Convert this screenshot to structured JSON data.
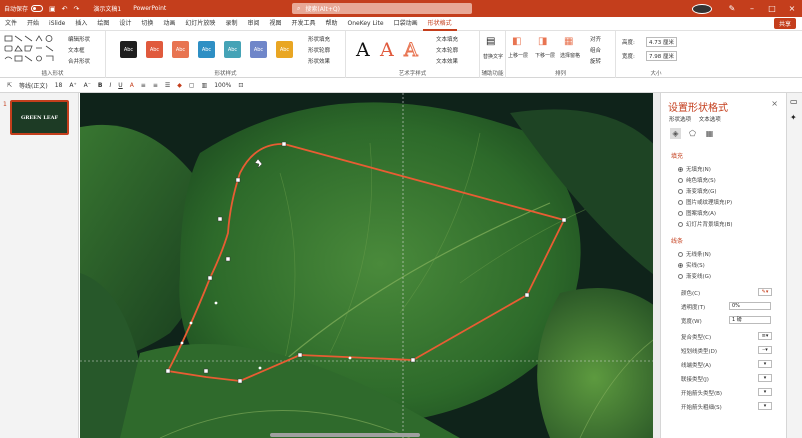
{
  "titlebar": {
    "autosave": "自动保存",
    "filename": "演示文稿1",
    "app": "PowerPoint",
    "search_placeholder": "搜索(Alt+Q)",
    "share": "共享"
  },
  "menus": [
    "文件",
    "开始",
    "iSlide",
    "插入",
    "绘图",
    "设计",
    "切换",
    "动画",
    "幻灯片放映",
    "录制",
    "审阅",
    "视图",
    "开发工具",
    "帮助",
    "OneKey Lite",
    "口袋动画",
    "形状格式"
  ],
  "ribbon": {
    "groups": {
      "insert": "插入形状",
      "styles": "形状样式",
      "wordart": "艺术字样式",
      "access": "辅助功能",
      "arrange": "排列",
      "size": "大小"
    },
    "insert_items": [
      "编辑形状",
      "文本框",
      "合并形状"
    ],
    "style_swatches": [
      {
        "label": "Abc",
        "color": "#1f1f1f"
      },
      {
        "label": "Abc",
        "color": "#e05a3d"
      },
      {
        "label": "Abc",
        "color": "#e87451"
      },
      {
        "label": "Abc",
        "color": "#2e8fc4"
      },
      {
        "label": "Abc",
        "color": "#45a3b6"
      },
      {
        "label": "Abc",
        "color": "#6f86c9"
      },
      {
        "label": "Abc",
        "color": "#e9a623"
      }
    ],
    "style_items": [
      "形状填充",
      "形状轮廓",
      "形状效果"
    ],
    "wordart_items": [
      "文本填充",
      "文本轮廓",
      "文本效果"
    ],
    "access_item": "替换文字",
    "arrange_items": [
      "上移一层",
      "下移一层",
      "选择窗格",
      "对齐",
      "组合",
      "旋转"
    ],
    "size": {
      "height_label": "高度:",
      "height": "4.73 厘米",
      "width_label": "宽度:",
      "width": "7.98 厘米"
    }
  },
  "toolbar2": {
    "font": "等线(正文)",
    "size": "18",
    "zoom": "100%"
  },
  "slide": {
    "number": "1",
    "thumb_title": "GREEN LEAF"
  },
  "panel": {
    "title": "设置形状格式",
    "tabs": [
      "形状选项",
      "文本选项"
    ],
    "fill_section": "填充",
    "fill_options": [
      "无填充(N)",
      "纯色填充(S)",
      "渐变填充(G)",
      "图片或纹理填充(P)",
      "图案填充(A)",
      "幻灯片背景填充(B)"
    ],
    "line_section": "线条",
    "line_options": [
      "无线条(N)",
      "实线(S)",
      "渐变线(G)"
    ],
    "props": [
      {
        "label": "颜色(C)",
        "value": ""
      },
      {
        "label": "透明度(T)",
        "value": "0%"
      },
      {
        "label": "宽度(W)",
        "value": "1 磅"
      },
      {
        "label": "复合类型(C)",
        "value": ""
      },
      {
        "label": "短划线类型(D)",
        "value": ""
      },
      {
        "label": "线端类型(A)",
        "value": ""
      },
      {
        "label": "联接类型(J)",
        "value": ""
      },
      {
        "label": "开始箭头类型(B)",
        "value": ""
      },
      {
        "label": "开始箭头粗细(S)",
        "value": ""
      }
    ],
    "accent": "#c43e1c"
  }
}
